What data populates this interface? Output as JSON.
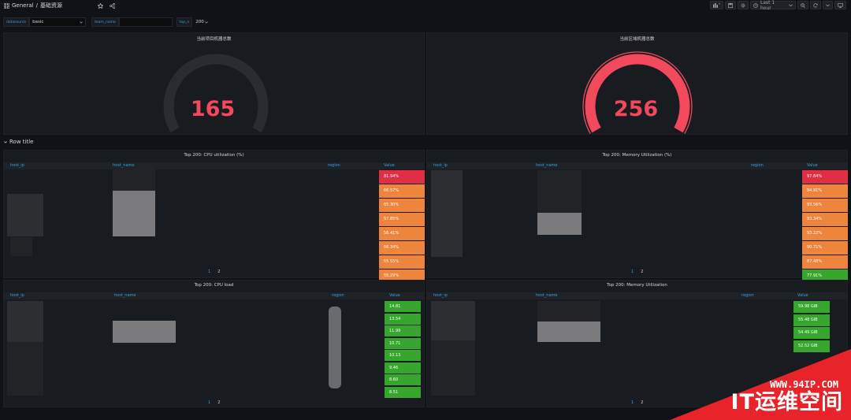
{
  "header": {
    "breadcrumb_folder": "General",
    "breadcrumb_sep": "/",
    "dashboard_title": "基础资源",
    "time_range": "Last 1 hour"
  },
  "variables": [
    {
      "label": "datasource",
      "value": "basic"
    },
    {
      "label": "team_name",
      "value": ""
    },
    {
      "label": "top_n",
      "value": "200"
    }
  ],
  "stats": [
    {
      "title": "当前项目机器总数",
      "value": "165",
      "gauge_fraction": 0.0
    },
    {
      "title": "当前区域机器总数",
      "value": "256",
      "gauge_fraction": 1.0
    }
  ],
  "row": {
    "title": "Row title"
  },
  "tables": [
    {
      "title": "Top 200: CPU utilization (%)",
      "columns": [
        "host_ip",
        "host_name",
        "region",
        "Value"
      ],
      "values": [
        "81.94%",
        "66.57%",
        "65.30%",
        "57.85%",
        "56.41%",
        "56.34%",
        "55.55%",
        "55.29%"
      ],
      "cell_colors": [
        "#e02f44",
        "#ef843c",
        "#ef843c",
        "#ef843c",
        "#ef843c",
        "#ef843c",
        "#ef843c",
        "#ef843c"
      ],
      "pages": [
        "1",
        "2"
      ]
    },
    {
      "title": "Top 200: Memory Utilization (%)",
      "columns": [
        "host_ip",
        "host_name",
        "region",
        "Value"
      ],
      "values": [
        "97.84%",
        "94.91%",
        "93.56%",
        "93.34%",
        "93.22%",
        "90.71%",
        "87.48%",
        "77.91%"
      ],
      "cell_colors": [
        "#e02f44",
        "#ef843c",
        "#ef843c",
        "#ef843c",
        "#ef843c",
        "#ef843c",
        "#ef843c",
        "#37a62d"
      ],
      "pages": [
        "1",
        "2"
      ]
    },
    {
      "title": "Top 200: CPU load",
      "columns": [
        "host_ip",
        "host_name",
        "region",
        "Value"
      ],
      "values": [
        "14.81",
        "13.54",
        "11.99",
        "10.71",
        "10.13",
        "9.46",
        "8.60",
        "8.51"
      ],
      "cell_colors": [
        "#37a62d",
        "#37a62d",
        "#37a62d",
        "#37a62d",
        "#37a62d",
        "#37a62d",
        "#37a62d",
        "#37a62d"
      ],
      "pages": [
        "1",
        "2"
      ]
    },
    {
      "title": "Top 200: Memory Utilization",
      "columns": [
        "host_ip",
        "host_name",
        "region",
        "Value"
      ],
      "values": [
        "59.98 GiB",
        "55.48 GiB",
        "54.49 GiB",
        "52.52 GiB"
      ],
      "cell_colors": [
        "#37a62d",
        "#37a62d",
        "#37a62d",
        "#37a62d"
      ],
      "pages": [
        "1",
        "2"
      ]
    }
  ],
  "watermark": {
    "url": "WWW.94IP.COM",
    "name": "IT运维空间"
  }
}
